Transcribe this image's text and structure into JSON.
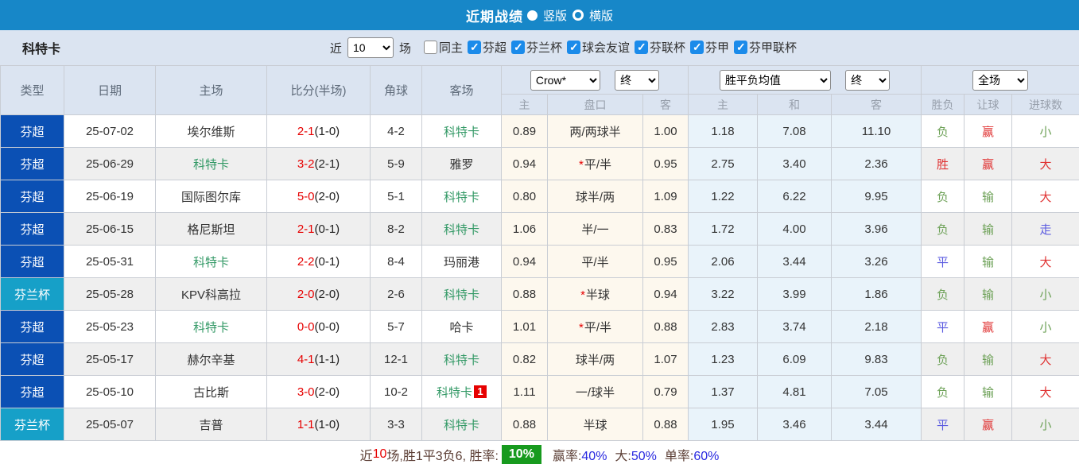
{
  "colors": {
    "topbar_blue": "#1787c8",
    "panel_blue_gray": "#dbe4f1",
    "league_super_blue": "#0b50b4",
    "league_cup_teal": "#16a0c8",
    "score_red": "#e60000",
    "self_team_green": "#339966",
    "result_red": "#e03333",
    "result_blue": "#5b5be0",
    "result_green": "#6da157",
    "footer_badge_green": "#179a1e",
    "footer_value_blue": "#2a2ae0"
  },
  "topbar": {
    "title": "近期战绩",
    "radio_vertical": "竖版",
    "radio_horizontal": "横版"
  },
  "filters": {
    "team": "科特卡",
    "recent_label": "近",
    "recent_value": "10",
    "games_label": "场",
    "checkboxes": [
      {
        "key": "same-home-away",
        "label": "同主",
        "checked": false
      },
      {
        "key": "finland-premier",
        "label": "芬超",
        "checked": true
      },
      {
        "key": "finland-cup",
        "label": "芬兰杯",
        "checked": true
      },
      {
        "key": "club-friendly",
        "label": "球会友谊",
        "checked": true
      },
      {
        "key": "finland-league-cup",
        "label": "芬联杯",
        "checked": true
      },
      {
        "key": "finland-div1",
        "label": "芬甲",
        "checked": true
      },
      {
        "key": "finland-div1-cup",
        "label": "芬甲联杯",
        "checked": true
      }
    ]
  },
  "table": {
    "headers": {
      "type": "类型",
      "date": "日期",
      "home": "主场",
      "score": "比分(半场)",
      "corner": "角球",
      "away": "客场",
      "ah_sub": [
        "主",
        "盘口",
        "客"
      ],
      "eu_sub": [
        "主",
        "和",
        "客"
      ],
      "result_sub": [
        "胜负",
        "让球",
        "进球数"
      ],
      "selects": {
        "company": "Crow*",
        "company_state": "终",
        "avg": "胜平负均值",
        "avg_state": "终",
        "scope": "全场"
      }
    },
    "rows": [
      {
        "type": "芬超",
        "type_cls": "league-super",
        "date": "25-07-02",
        "home": "埃尔维斯",
        "home_self": false,
        "score": "2-1",
        "half": "(1-0)",
        "corner": "4-2",
        "away": "科特卡",
        "away_self": true,
        "badge": "",
        "ah_home": "0.89",
        "ah_star": false,
        "ah_line": "两/两球半",
        "ah_away": "1.00",
        "eu_home": "1.18",
        "eu_draw": "7.08",
        "eu_away": "11.10",
        "r_wdl": "负",
        "r_wdl_c": "g",
        "r_ah": "赢",
        "r_ah_c": "r",
        "r_ou": "小",
        "r_ou_c": "g"
      },
      {
        "type": "芬超",
        "type_cls": "league-super",
        "date": "25-06-29",
        "home": "科特卡",
        "home_self": true,
        "score": "3-2",
        "half": "(2-1)",
        "corner": "5-9",
        "away": "雅罗",
        "away_self": false,
        "badge": "",
        "ah_home": "0.94",
        "ah_star": true,
        "ah_line": "平/半",
        "ah_away": "0.95",
        "eu_home": "2.75",
        "eu_draw": "3.40",
        "eu_away": "2.36",
        "r_wdl": "胜",
        "r_wdl_c": "r",
        "r_ah": "赢",
        "r_ah_c": "r",
        "r_ou": "大",
        "r_ou_c": "r"
      },
      {
        "type": "芬超",
        "type_cls": "league-super",
        "date": "25-06-19",
        "home": "国际图尔库",
        "home_self": false,
        "score": "5-0",
        "half": "(2-0)",
        "corner": "5-1",
        "away": "科特卡",
        "away_self": true,
        "badge": "",
        "ah_home": "0.80",
        "ah_star": false,
        "ah_line": "球半/两",
        "ah_away": "1.09",
        "eu_home": "1.22",
        "eu_draw": "6.22",
        "eu_away": "9.95",
        "r_wdl": "负",
        "r_wdl_c": "g",
        "r_ah": "输",
        "r_ah_c": "g",
        "r_ou": "大",
        "r_ou_c": "r"
      },
      {
        "type": "芬超",
        "type_cls": "league-super",
        "date": "25-06-15",
        "home": "格尼斯坦",
        "home_self": false,
        "score": "2-1",
        "half": "(0-1)",
        "corner": "8-2",
        "away": "科特卡",
        "away_self": true,
        "badge": "",
        "ah_home": "1.06",
        "ah_star": false,
        "ah_line": "半/一",
        "ah_away": "0.83",
        "eu_home": "1.72",
        "eu_draw": "4.00",
        "eu_away": "3.96",
        "r_wdl": "负",
        "r_wdl_c": "g",
        "r_ah": "输",
        "r_ah_c": "g",
        "r_ou": "走",
        "r_ou_c": "b"
      },
      {
        "type": "芬超",
        "type_cls": "league-super",
        "date": "25-05-31",
        "home": "科特卡",
        "home_self": true,
        "score": "2-2",
        "half": "(0-1)",
        "corner": "8-4",
        "away": "玛丽港",
        "away_self": false,
        "badge": "",
        "ah_home": "0.94",
        "ah_star": false,
        "ah_line": "平/半",
        "ah_away": "0.95",
        "eu_home": "2.06",
        "eu_draw": "3.44",
        "eu_away": "3.26",
        "r_wdl": "平",
        "r_wdl_c": "b",
        "r_ah": "输",
        "r_ah_c": "g",
        "r_ou": "大",
        "r_ou_c": "r"
      },
      {
        "type": "芬兰杯",
        "type_cls": "league-cup",
        "date": "25-05-28",
        "home": "KPV科高拉",
        "home_self": false,
        "score": "2-0",
        "half": "(2-0)",
        "corner": "2-6",
        "away": "科特卡",
        "away_self": true,
        "badge": "",
        "ah_home": "0.88",
        "ah_star": true,
        "ah_line": "半球",
        "ah_away": "0.94",
        "eu_home": "3.22",
        "eu_draw": "3.99",
        "eu_away": "1.86",
        "r_wdl": "负",
        "r_wdl_c": "g",
        "r_ah": "输",
        "r_ah_c": "g",
        "r_ou": "小",
        "r_ou_c": "g"
      },
      {
        "type": "芬超",
        "type_cls": "league-super",
        "date": "25-05-23",
        "home": "科特卡",
        "home_self": true,
        "score": "0-0",
        "half": "(0-0)",
        "corner": "5-7",
        "away": "哈卡",
        "away_self": false,
        "badge": "",
        "ah_home": "1.01",
        "ah_star": true,
        "ah_line": "平/半",
        "ah_away": "0.88",
        "eu_home": "2.83",
        "eu_draw": "3.74",
        "eu_away": "2.18",
        "r_wdl": "平",
        "r_wdl_c": "b",
        "r_ah": "赢",
        "r_ah_c": "r",
        "r_ou": "小",
        "r_ou_c": "g"
      },
      {
        "type": "芬超",
        "type_cls": "league-super",
        "date": "25-05-17",
        "home": "赫尔辛基",
        "home_self": false,
        "score": "4-1",
        "half": "(1-1)",
        "corner": "12-1",
        "away": "科特卡",
        "away_self": true,
        "badge": "",
        "ah_home": "0.82",
        "ah_star": false,
        "ah_line": "球半/两",
        "ah_away": "1.07",
        "eu_home": "1.23",
        "eu_draw": "6.09",
        "eu_away": "9.83",
        "r_wdl": "负",
        "r_wdl_c": "g",
        "r_ah": "输",
        "r_ah_c": "g",
        "r_ou": "大",
        "r_ou_c": "r"
      },
      {
        "type": "芬超",
        "type_cls": "league-super",
        "date": "25-05-10",
        "home": "古比斯",
        "home_self": false,
        "score": "3-0",
        "half": "(2-0)",
        "corner": "10-2",
        "away": "科特卡",
        "away_self": true,
        "badge": "1",
        "ah_home": "1.11",
        "ah_star": false,
        "ah_line": "一/球半",
        "ah_away": "0.79",
        "eu_home": "1.37",
        "eu_draw": "4.81",
        "eu_away": "7.05",
        "r_wdl": "负",
        "r_wdl_c": "g",
        "r_ah": "输",
        "r_ah_c": "g",
        "r_ou": "大",
        "r_ou_c": "r"
      },
      {
        "type": "芬兰杯",
        "type_cls": "league-cup",
        "date": "25-05-07",
        "home": "吉普",
        "home_self": false,
        "score": "1-1",
        "half": "(1-0)",
        "corner": "3-3",
        "away": "科特卡",
        "away_self": true,
        "badge": "",
        "ah_home": "0.88",
        "ah_star": false,
        "ah_line": "半球",
        "ah_away": "0.88",
        "eu_home": "1.95",
        "eu_draw": "3.46",
        "eu_away": "3.44",
        "r_wdl": "平",
        "r_wdl_c": "b",
        "r_ah": "赢",
        "r_ah_c": "r",
        "r_ou": "小",
        "r_ou_c": "g"
      }
    ]
  },
  "footer": {
    "prefix": "近",
    "games": "10",
    "middle": "场,胜1平3负6, 胜率:",
    "win_rate": "10%",
    "handicap_label": "赢率:",
    "handicap_value": "40%",
    "big_label": "大:",
    "big_value": "50%",
    "single_label": "单率:",
    "single_value": "60%"
  }
}
